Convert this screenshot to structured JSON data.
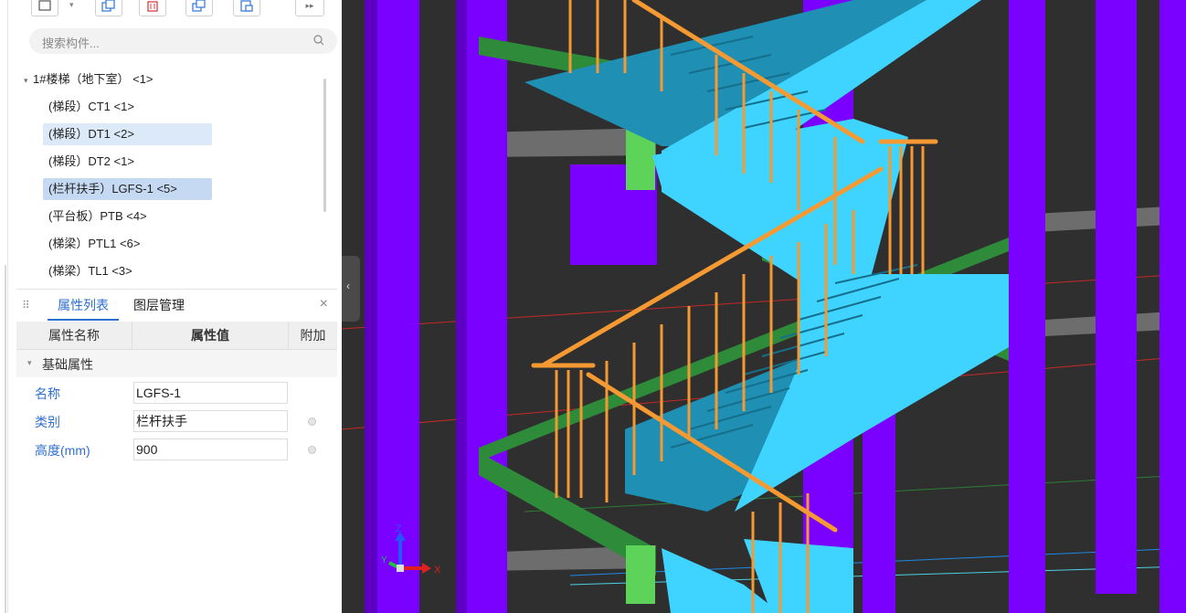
{
  "toolbar": {
    "buttons": [
      "new-icon",
      "copy-icon",
      "delete-icon",
      "copy-floor-icon",
      "paste-icon",
      "more-icon"
    ]
  },
  "search": {
    "placeholder": "搜索构件..."
  },
  "tree": {
    "root": "1#楼梯（地下室） <1>",
    "items": [
      "(梯段）CT1 <1>",
      "(梯段）DT1 <2>",
      "(梯段）DT2 <1>",
      "(栏杆扶手）LGFS-1 <5>",
      "(平台板）PTB <4>",
      "(梯梁）PTL1 <6>",
      "(梯梁）TL1 <3>"
    ]
  },
  "props_panel": {
    "tabs": [
      "属性列表",
      "图层管理"
    ],
    "close": "×",
    "columns": [
      "属性名称",
      "属性值",
      "附加"
    ],
    "group": "基础属性",
    "rows": [
      {
        "name": "名称",
        "value": "LGFS-1"
      },
      {
        "name": "类别",
        "value": "栏杆扶手"
      },
      {
        "name": "高度(mm)",
        "value": "900"
      }
    ]
  },
  "viewport": {
    "axes": {
      "x": "X",
      "y": "Y",
      "z": "Z"
    },
    "colors": {
      "background": "#2f2f2f",
      "column": "#7a00ff",
      "stair": "#3fd4ff",
      "stair_side": "#1f8fb3",
      "railing": "#f59a32",
      "slab_edge": "#2e8b3a",
      "beam_end": "#5ed35a"
    }
  }
}
